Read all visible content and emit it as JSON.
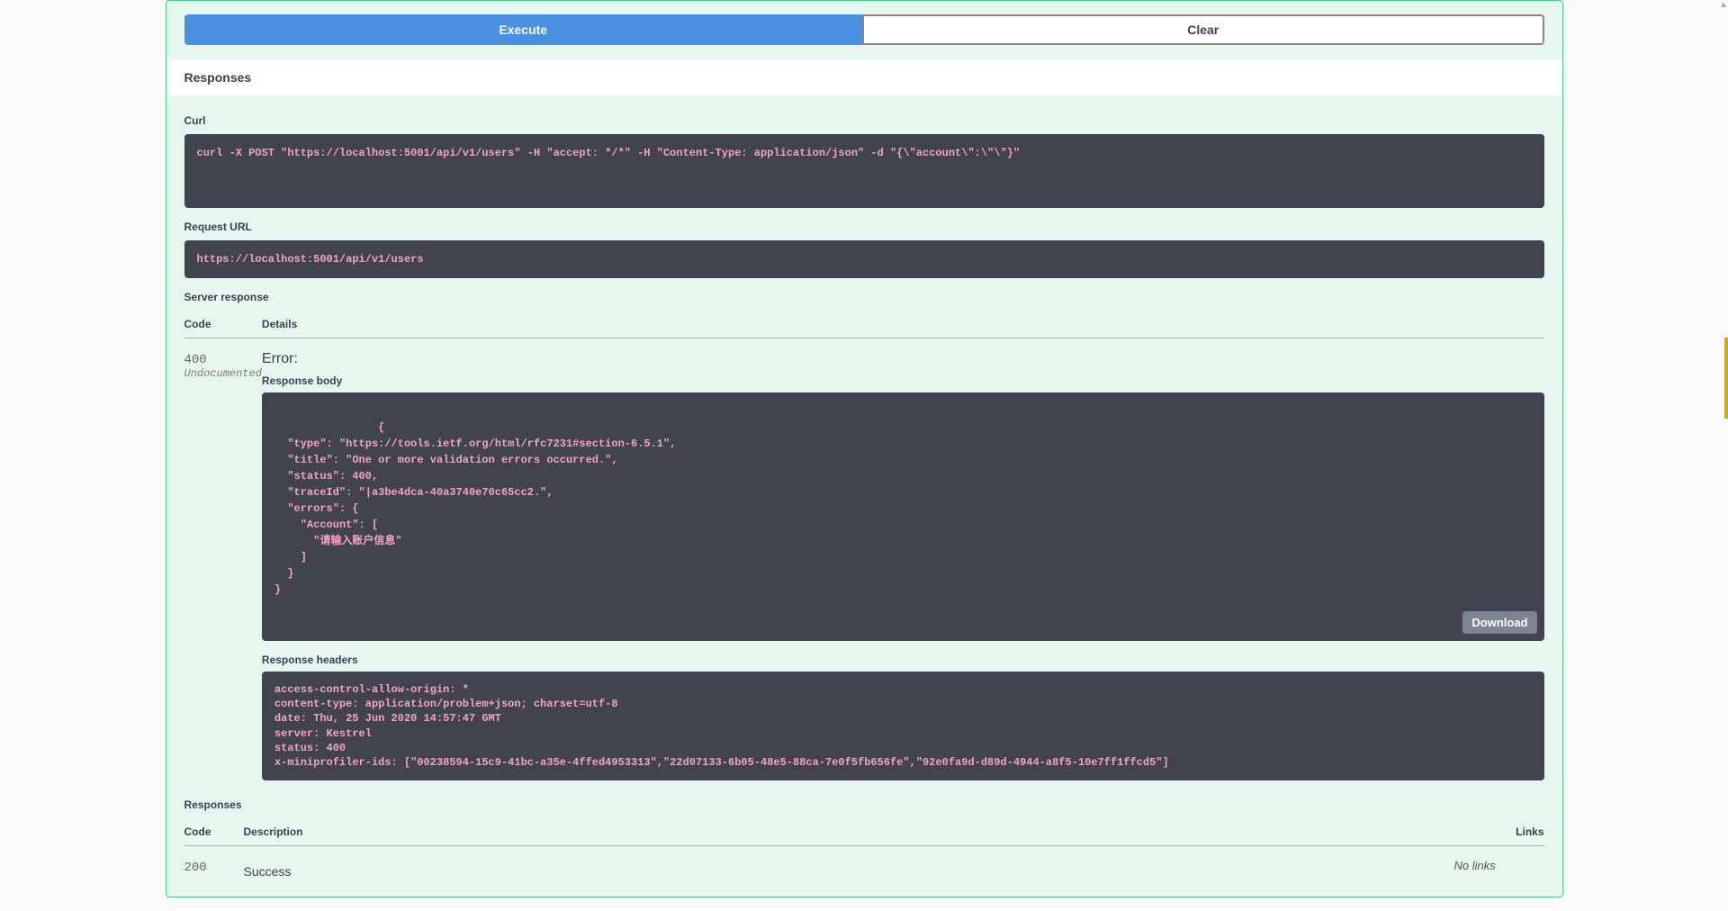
{
  "buttons": {
    "execute": "Execute",
    "clear": "Clear",
    "download": "Download"
  },
  "sections": {
    "responses_header": "Responses",
    "curl_label": "Curl",
    "request_url_label": "Request URL",
    "server_response_label": "Server response",
    "responses_label": "Responses"
  },
  "curl_command": "curl -X POST \"https://localhost:5001/api/v1/users\" -H \"accept: */*\" -H \"Content-Type: application/json\" -d \"{\\\"account\\\":\\\"\\\"}\"",
  "request_url": "https://localhost:5001/api/v1/users",
  "server_response": {
    "headers": {
      "code": "Code",
      "details": "Details"
    },
    "code": "400",
    "code_note": "Undocumented",
    "error_label": "Error:",
    "response_body_label": "Response body",
    "response_body": "{\n  \"type\": \"https://tools.ietf.org/html/rfc7231#section-6.5.1\",\n  \"title\": \"One or more validation errors occurred.\",\n  \"status\": 400,\n  \"traceId\": \"|a3be4dca-40a3740e70c65cc2.\",\n  \"errors\": {\n    \"Account\": [\n      \"请输入账户信息\"\n    ]\n  }\n}",
    "response_headers_label": "Response headers",
    "response_headers": "access-control-allow-origin: *\ncontent-type: application/problem+json; charset=utf-8\ndate: Thu, 25 Jun 2020 14:57:47 GMT\nserver: Kestrel\nstatus: 400\nx-miniprofiler-ids: [\"00238594-15c9-41bc-a35e-4ffed4953313\",\"22d07133-6b05-48e5-88ca-7e0f5fb656fe\",\"92e0fa9d-d89d-4944-a8f5-10e7ff1ffcd5\"]"
  },
  "responses_table": {
    "headers": {
      "code": "Code",
      "description": "Description",
      "links": "Links"
    },
    "row_200": {
      "code": "200",
      "description": "Success",
      "links": "No links"
    }
  }
}
